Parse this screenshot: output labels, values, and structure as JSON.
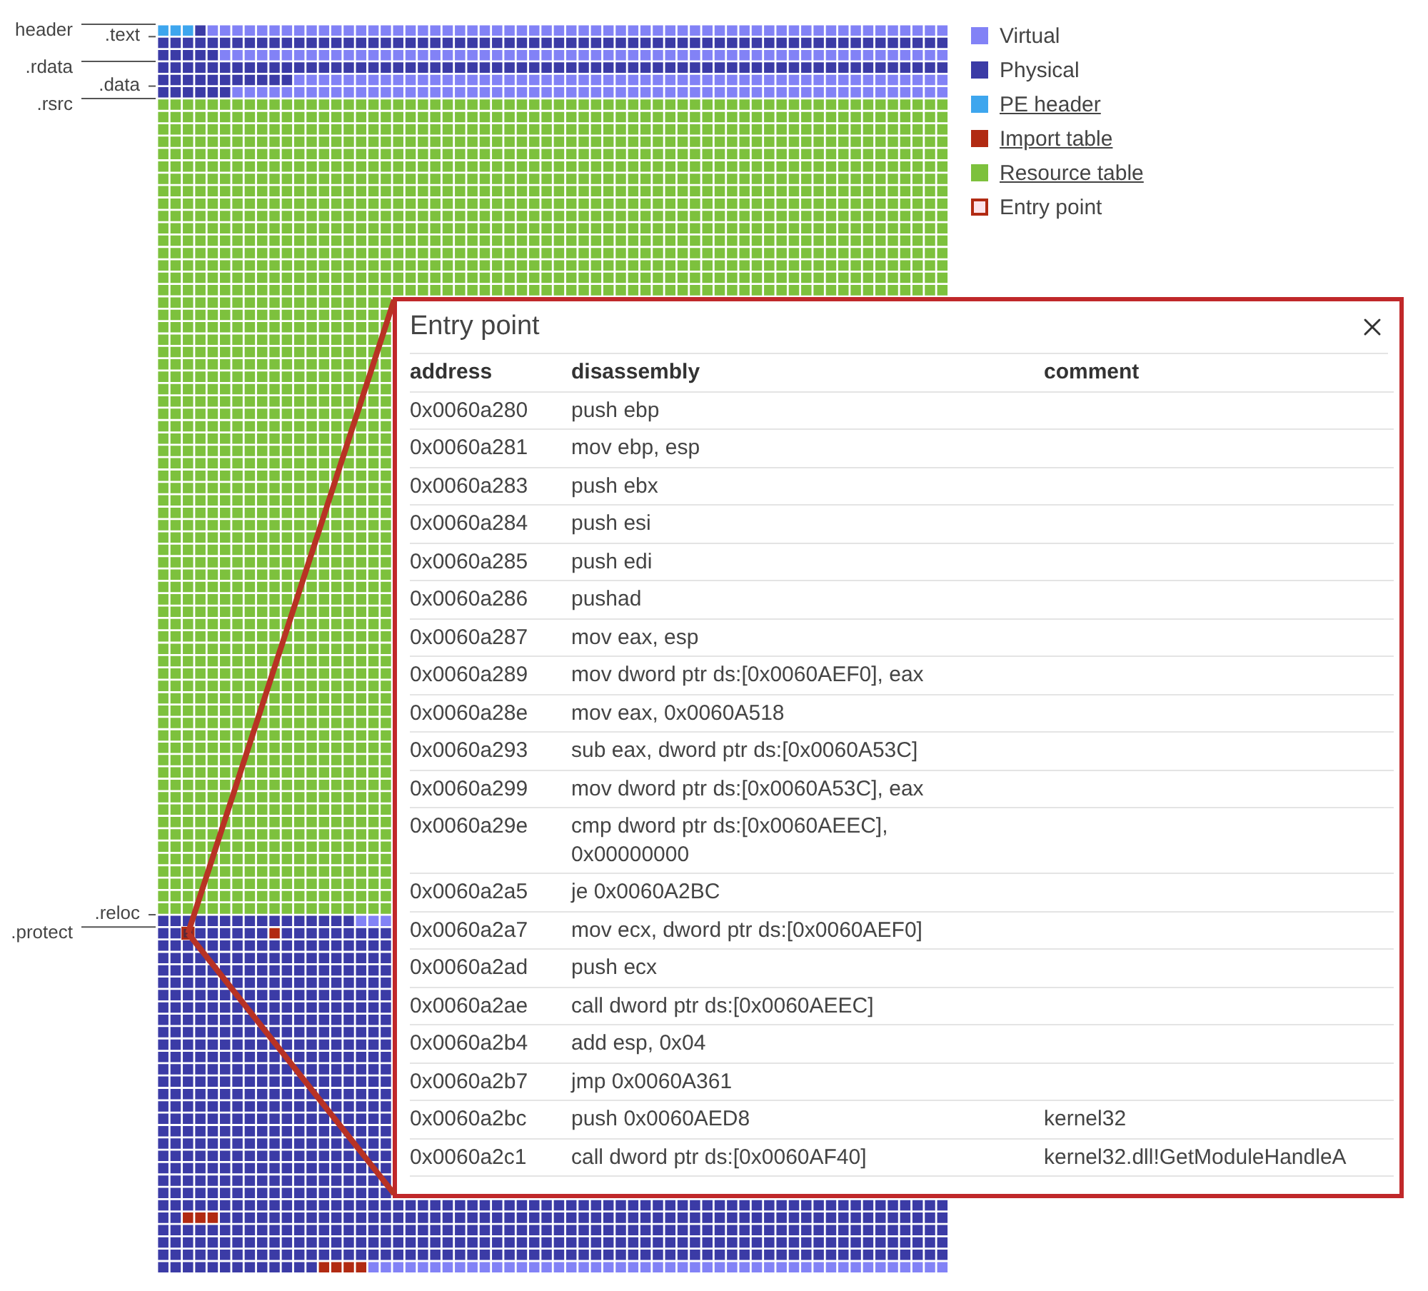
{
  "sections": [
    {
      "label": "header"
    },
    {
      "label": ".text"
    },
    {
      "label": ".rdata"
    },
    {
      "label": ".data"
    },
    {
      "label": ".rsrc"
    },
    {
      "label": ".reloc"
    },
    {
      "label": ".protect"
    }
  ],
  "legend": [
    {
      "label": "Virtual",
      "kind": "virtual",
      "color": "#8282f6",
      "link": false
    },
    {
      "label": "Physical",
      "kind": "physical",
      "color": "#3b3ba6",
      "link": false
    },
    {
      "label": "PE header",
      "kind": "header",
      "color": "#3ea6ee",
      "link": true
    },
    {
      "label": "Import table",
      "kind": "import",
      "color": "#b12a12",
      "link": true
    },
    {
      "label": "Resource table",
      "kind": "resource",
      "color": "#7dc13d",
      "link": true
    },
    {
      "label": "Entry point",
      "kind": "entry",
      "color": "#b12a12",
      "link": false
    }
  ],
  "popup": {
    "title": "Entry point",
    "columns": [
      "address",
      "disassembly",
      "comment"
    ],
    "rows": [
      {
        "address": "0x0060a280",
        "disassembly": "push ebp"
      },
      {
        "address": "0x0060a281",
        "disassembly": "mov ebp, esp"
      },
      {
        "address": "0x0060a283",
        "disassembly": "push ebx"
      },
      {
        "address": "0x0060a284",
        "disassembly": "push esi"
      },
      {
        "address": "0x0060a285",
        "disassembly": "push edi"
      },
      {
        "address": "0x0060a286",
        "disassembly": "pushad"
      },
      {
        "address": "0x0060a287",
        "disassembly": "mov eax, esp"
      },
      {
        "address": "0x0060a289",
        "disassembly": "mov dword ptr ds:[0x0060AEF0], eax"
      },
      {
        "address": "0x0060a28e",
        "disassembly": "mov eax, 0x0060A518"
      },
      {
        "address": "0x0060a293",
        "disassembly": "sub eax, dword ptr ds:[0x0060A53C]"
      },
      {
        "address": "0x0060a299",
        "disassembly": "mov dword ptr ds:[0x0060A53C], eax"
      },
      {
        "address": "0x0060a29e",
        "disassembly": "cmp dword ptr ds:[0x0060AEEC], 0x00000000"
      },
      {
        "address": "0x0060a2a5",
        "disassembly": "je 0x0060A2BC"
      },
      {
        "address": "0x0060a2a7",
        "disassembly": "mov ecx, dword ptr ds:[0x0060AEF0]"
      },
      {
        "address": "0x0060a2ad",
        "disassembly": "push ecx"
      },
      {
        "address": "0x0060a2ae",
        "disassembly": "call dword ptr ds:[0x0060AEEC]"
      },
      {
        "address": "0x0060a2b4",
        "disassembly": "add esp, 0x04"
      },
      {
        "address": "0x0060a2b7",
        "disassembly": "jmp 0x0060A361"
      },
      {
        "address": "0x0060a2bc",
        "disassembly": "push 0x0060AED8",
        "comment": "kernel32"
      },
      {
        "address": "0x0060a2c1",
        "disassembly": "call dword ptr ds:[0x0060AF40]",
        "comment": "kernel32.dll!GetModuleHandleA"
      }
    ]
  }
}
